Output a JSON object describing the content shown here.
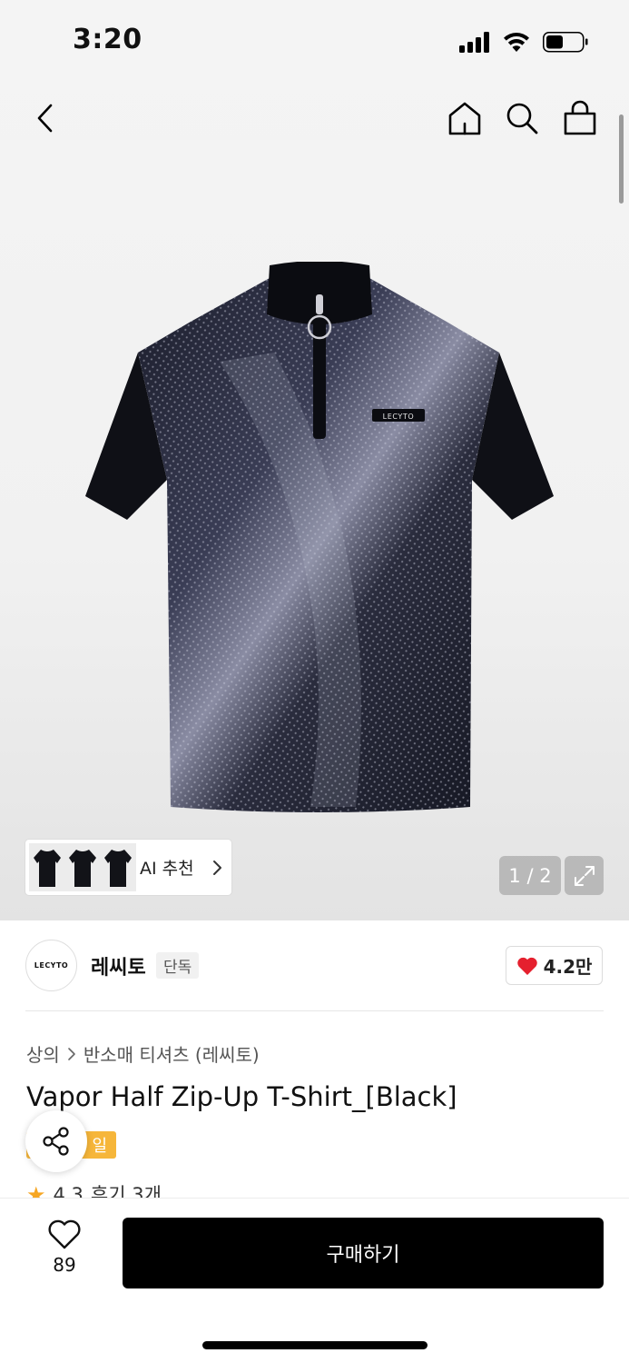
{
  "status_bar": {
    "time": "3:20"
  },
  "nav": {
    "back_icon": "chevron-left-icon",
    "home_icon": "home-icon",
    "search_icon": "search-icon",
    "bag_icon": "shopping-bag-icon"
  },
  "hero": {
    "ai_recommend_label": "AI 추천",
    "image_logo_text": "LECYTO",
    "pager": "1 / 2"
  },
  "brand": {
    "logo_text": "LECYTO",
    "name": "레씨토",
    "badge": "단독",
    "like_count": "4.2만"
  },
  "breadcrumb": {
    "category": "상의",
    "subcategory": "반소매 티셔츠 (레씨토)"
  },
  "product": {
    "title": "Vapor Half Zip-Up T-Shirt_[Black]",
    "sale_badge": "일",
    "rating": "4.3",
    "reviews": "후기 3개"
  },
  "bottom_bar": {
    "wish_count": "89",
    "buy_label": "구매하기"
  },
  "colors": {
    "accent_sale": "#f6b63a",
    "heart": "#e5202e",
    "star": "#f6a623",
    "buy_bg": "#000000"
  }
}
